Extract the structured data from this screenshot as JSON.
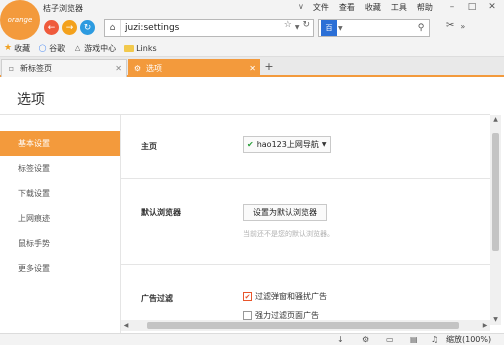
{
  "app": {
    "logo_text": "orange",
    "title": "桔子浏览器"
  },
  "menu": [
    "文件",
    "查看",
    "收藏",
    "工具",
    "帮助"
  ],
  "address": {
    "url": "juzi:settings"
  },
  "search": {
    "engine_label": "百",
    "placeholder": ""
  },
  "bookmarks": [
    {
      "label": "收藏",
      "icon": "star-icon"
    },
    {
      "label": "谷歌",
      "icon": "google-icon"
    },
    {
      "label": "游戏中心",
      "icon": "gamepad-icon"
    },
    {
      "label": "Links",
      "icon": "folder-icon"
    }
  ],
  "tabs": [
    {
      "label": "新标签页",
      "active": false
    },
    {
      "label": "选项",
      "active": true
    }
  ],
  "page": {
    "title": "选项"
  },
  "sidebar": {
    "items": [
      {
        "label": "基本设置",
        "active": true
      },
      {
        "label": "标签设置",
        "active": false
      },
      {
        "label": "下载设置",
        "active": false
      },
      {
        "label": "上网痕迹",
        "active": false
      },
      {
        "label": "鼠标手势",
        "active": false
      },
      {
        "label": "更多设置",
        "active": false
      }
    ]
  },
  "settings": {
    "home": {
      "label": "主页",
      "value": "hao123上网导航"
    },
    "default_browser": {
      "label": "默认浏览器",
      "button": "设置为默认浏览器",
      "hint": "当前还不是您的默认浏览器。"
    },
    "ad_filter": {
      "label": "广告过滤",
      "options": [
        {
          "label": "过滤弹窗和骚扰广告",
          "checked": true
        },
        {
          "label": "强力过滤页面广告",
          "checked": false
        }
      ]
    }
  },
  "status": {
    "zoom": "缩放(100%)"
  },
  "colors": {
    "accent": "#f39a3c",
    "back_button": "#ef5a3c",
    "forward_button": "#f3a11c",
    "refresh_button": "#2d9be0"
  }
}
